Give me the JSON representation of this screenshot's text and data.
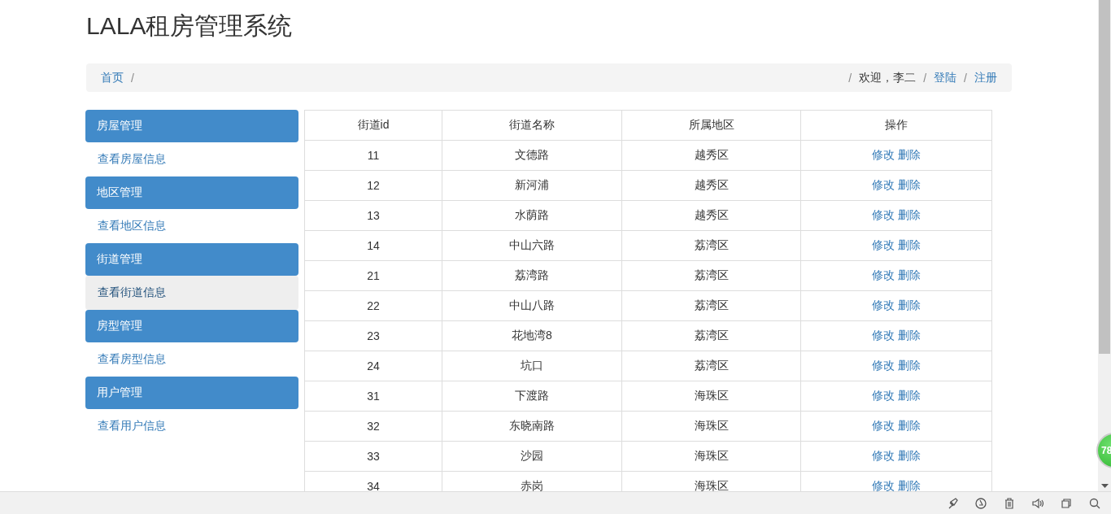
{
  "title": "LALA租房管理系统",
  "breadcrumb": {
    "left": [
      {
        "kind": "link",
        "text": "首页"
      },
      {
        "kind": "separator",
        "text": "/"
      }
    ],
    "right": [
      {
        "kind": "separator",
        "text": "/"
      },
      {
        "kind": "text",
        "text": "欢迎，李二"
      },
      {
        "kind": "separator",
        "text": "/"
      },
      {
        "kind": "link",
        "text": "登陆"
      },
      {
        "kind": "separator",
        "text": "/"
      },
      {
        "kind": "link",
        "text": "注册"
      }
    ]
  },
  "sidebar": {
    "groups": [
      {
        "title": "房屋管理",
        "items": [
          {
            "label": "查看房屋信息",
            "selected": false
          }
        ]
      },
      {
        "title": "地区管理",
        "items": [
          {
            "label": "查看地区信息",
            "selected": false
          }
        ]
      },
      {
        "title": "街道管理",
        "items": [
          {
            "label": "查看街道信息",
            "selected": true
          }
        ]
      },
      {
        "title": "房型管理",
        "items": [
          {
            "label": "查看房型信息",
            "selected": false
          }
        ]
      },
      {
        "title": "用户管理",
        "items": [
          {
            "label": "查看用户信息",
            "selected": false
          }
        ]
      }
    ]
  },
  "table": {
    "columns": [
      "街道id",
      "街道名称",
      "所属地区",
      "操作"
    ],
    "rows": [
      {
        "id": "11",
        "name": "文德路",
        "region": "越秀区",
        "actions": [
          "修改",
          "删除"
        ]
      },
      {
        "id": "12",
        "name": "新河浦",
        "region": "越秀区",
        "actions": [
          "修改",
          "删除"
        ]
      },
      {
        "id": "13",
        "name": "水荫路",
        "region": "越秀区",
        "actions": [
          "修改",
          "删除"
        ]
      },
      {
        "id": "14",
        "name": "中山六路",
        "region": "荔湾区",
        "actions": [
          "修改",
          "删除"
        ]
      },
      {
        "id": "21",
        "name": "荔湾路",
        "region": "荔湾区",
        "actions": [
          "修改",
          "删除"
        ]
      },
      {
        "id": "22",
        "name": "中山八路",
        "region": "荔湾区",
        "actions": [
          "修改",
          "删除"
        ]
      },
      {
        "id": "23",
        "name": "花地湾8",
        "region": "荔湾区",
        "actions": [
          "修改",
          "删除"
        ]
      },
      {
        "id": "24",
        "name": "坑口",
        "region": "荔湾区",
        "actions": [
          "修改",
          "删除"
        ]
      },
      {
        "id": "31",
        "name": "下渡路",
        "region": "海珠区",
        "actions": [
          "修改",
          "删除"
        ]
      },
      {
        "id": "32",
        "name": "东晓南路",
        "region": "海珠区",
        "actions": [
          "修改",
          "删除"
        ]
      },
      {
        "id": "33",
        "name": "沙园",
        "region": "海珠区",
        "actions": [
          "修改",
          "删除"
        ]
      },
      {
        "id": "34",
        "name": "赤岗",
        "region": "海珠区",
        "actions": [
          "修改",
          "删除"
        ]
      }
    ]
  },
  "floating_badge": {
    "text": "78"
  }
}
